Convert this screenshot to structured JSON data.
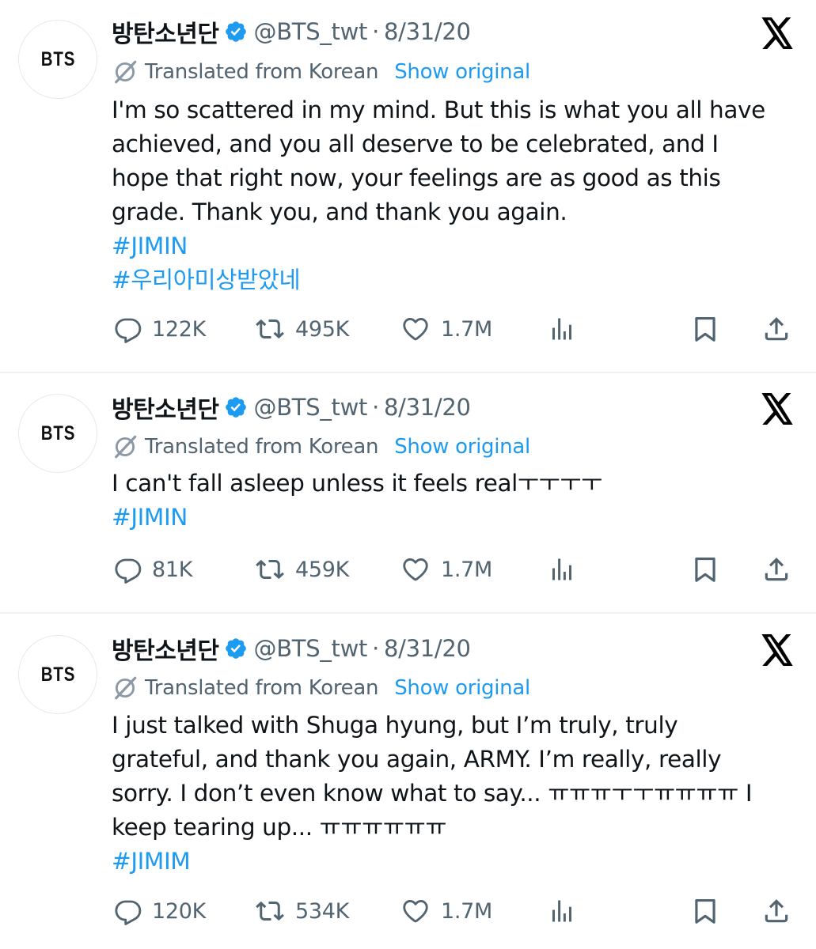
{
  "tweets": [
    {
      "avatar_text": "BTS",
      "display_name": "방탄소년단",
      "handle": "@BTS_twt",
      "separator": "·",
      "date": "8/31/20",
      "translated_label": "Translated from Korean",
      "show_original": "Show original",
      "text": [
        "I'm so scattered in my mind. But this is what you all have",
        "achieved, and you all deserve to be celebrated, and I",
        "hope that right now, your feelings are as good as this",
        "grade. Thank you, and thank you again."
      ],
      "hashtags": [
        "#JIMIN",
        "#우리아미상받았네"
      ],
      "stats": {
        "replies": "122K",
        "reposts": "495K",
        "likes": "1.7M"
      }
    },
    {
      "avatar_text": "BTS",
      "display_name": "방탄소년단",
      "handle": "@BTS_twt",
      "separator": "·",
      "date": "8/31/20",
      "translated_label": "Translated from Korean",
      "show_original": "Show original",
      "text": [
        "I can't fall asleep unless it feels realㅜㅜㅜㅜ"
      ],
      "hashtags": [
        "#JIMIN"
      ],
      "stats": {
        "replies": "81K",
        "reposts": "459K",
        "likes": "1.7M"
      }
    },
    {
      "avatar_text": "BTS",
      "display_name": "방탄소년단",
      "handle": "@BTS_twt",
      "separator": "·",
      "date": "8/31/20",
      "translated_label": "Translated from Korean",
      "show_original": "Show original",
      "text": [
        "I just talked with Shuga hyung, but I’m truly, truly",
        "grateful, and thank you again, ARMY. I’m really, really",
        "sorry. I don’t even know what to say... ㅠㅠㅠㅜㅜㅠㅠㅠㅠ I",
        "keep tearing up... ㅠㅠㅠㅠㅠㅠ"
      ],
      "hashtags": [
        "#JIMIM"
      ],
      "stats": {
        "replies": "120K",
        "reposts": "534K",
        "likes": "1.7M"
      }
    }
  ],
  "icons": {
    "verified": "verified-badge-icon",
    "platform": "x-logo-icon",
    "translate": "translate-globe-icon",
    "reply": "reply-icon",
    "repost": "repost-icon",
    "like": "like-heart-icon",
    "views": "views-chart-icon",
    "bookmark": "bookmark-icon",
    "share": "share-icon"
  },
  "colors": {
    "link": "#1d9bf0",
    "secondary_text": "#536471",
    "primary_text": "#0f1419",
    "divider": "#eff3f4"
  }
}
